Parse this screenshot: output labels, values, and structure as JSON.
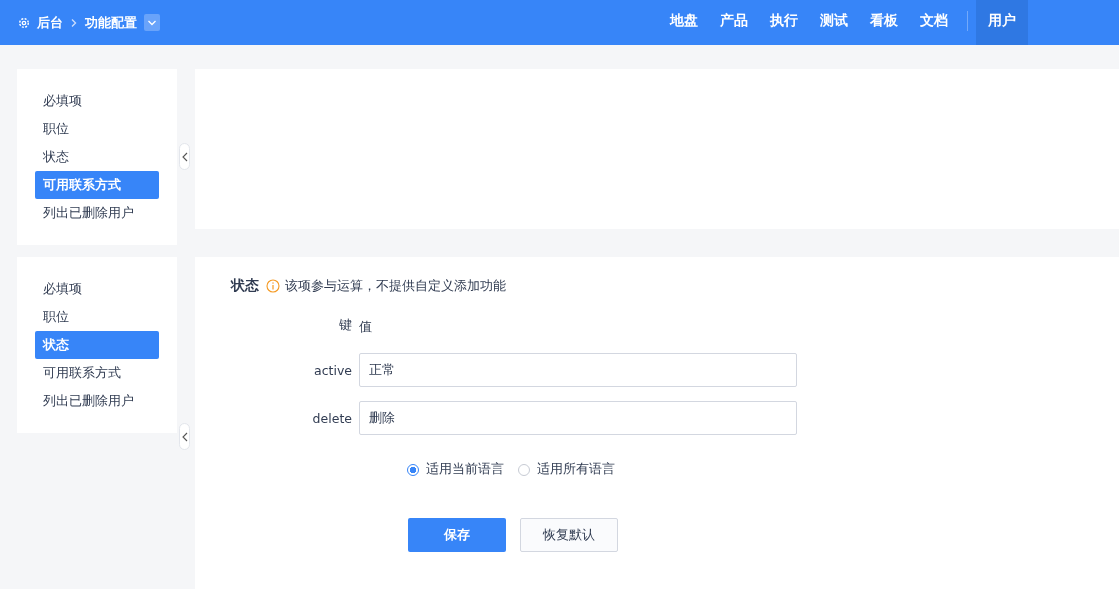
{
  "header": {
    "home": "后台",
    "breadcrumb": "功能配置",
    "nav": [
      {
        "label": "地盘",
        "selected": false
      },
      {
        "label": "产品",
        "selected": false
      },
      {
        "label": "执行",
        "selected": false
      },
      {
        "label": "测试",
        "selected": false
      },
      {
        "label": "看板",
        "selected": false
      },
      {
        "label": "文档",
        "selected": false
      }
    ],
    "user": {
      "label": "用户",
      "selected": true
    }
  },
  "upper_panel": {
    "menu": [
      {
        "label": "必填项",
        "selected": false
      },
      {
        "label": "职位",
        "selected": false
      },
      {
        "label": "状态",
        "selected": false
      },
      {
        "label": "可用联系方式",
        "selected": true
      },
      {
        "label": "列出已删除用户",
        "selected": false
      }
    ]
  },
  "lower_panel": {
    "menu": [
      {
        "label": "必填项",
        "selected": false
      },
      {
        "label": "职位",
        "selected": false
      },
      {
        "label": "状态",
        "selected": true
      },
      {
        "label": "可用联系方式",
        "selected": false
      },
      {
        "label": "列出已删除用户",
        "selected": false
      }
    ],
    "form": {
      "title": "状态",
      "notice": "该项参与运算，不提供自定义添加功能",
      "key_header": "键",
      "value_header": "值",
      "rows": [
        {
          "key": "active",
          "value": "正常"
        },
        {
          "key": "delete",
          "value": "删除"
        }
      ],
      "language_options": [
        {
          "label": "适用当前语言",
          "selected": true
        },
        {
          "label": "适用所有语言",
          "selected": false
        }
      ],
      "save": "保存",
      "reset": "恢复默认"
    }
  }
}
